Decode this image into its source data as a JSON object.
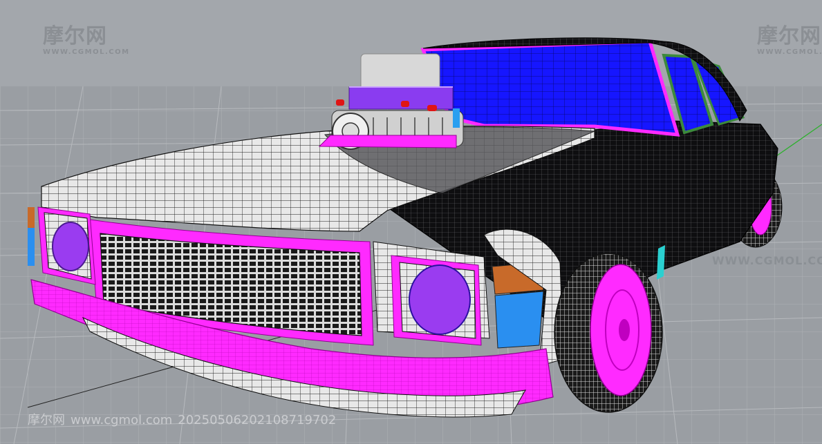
{
  "watermark": {
    "logo_text": "摩尔网",
    "logo_subtext": "WWW.CGMOL.COM",
    "mid_text": "WWW.CGMOL.COM",
    "footer_brand": "摩尔网",
    "footer_url": "www.cgmol.com",
    "footer_id": "20250506202108719702"
  },
  "model": {
    "subject": "classic sedan wireframe with supercharged engine",
    "colors": {
      "background": "#9a9ea3",
      "grid_line": "#b8bbbf",
      "body_dark": "#111114",
      "panel_white": "#e6e6e6",
      "chrome_magenta": "#ff26ff",
      "glass_blue": "#1a1aff",
      "headlight_purple": "#9a3cf0",
      "indicator_orange": "#c86a2a",
      "indicator_blue": "#2a8ff0",
      "window_trim_green": "#3c8a3c",
      "axis_green": "#2db02d"
    }
  }
}
